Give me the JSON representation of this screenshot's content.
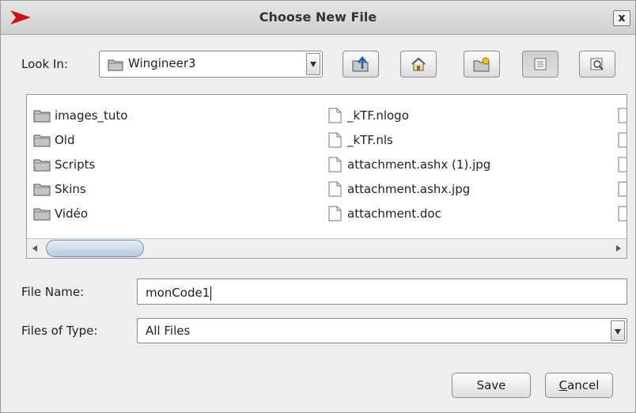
{
  "dialog": {
    "title": "Choose New File",
    "close_label": "x"
  },
  "look_in": {
    "label": "Look In:",
    "value": "Wingineer3"
  },
  "toolbar": [
    "up-one-level",
    "home",
    "new-folder",
    "list-view",
    "details-view"
  ],
  "folders": [
    {
      "name": "images_tuto"
    },
    {
      "name": "Old"
    },
    {
      "name": "Scripts"
    },
    {
      "name": "Skins"
    },
    {
      "name": "Vidéo"
    }
  ],
  "files": [
    {
      "name": "_kTF.nlogo"
    },
    {
      "name": "_kTF.nls"
    },
    {
      "name": "attachment.ashx (1).jpg"
    },
    {
      "name": "attachment.ashx.jpg"
    },
    {
      "name": "attachment.doc"
    }
  ],
  "file_name": {
    "label": "File Name:",
    "value": "monCode1"
  },
  "files_of_type": {
    "label": "Files of Type:",
    "value": "All Files"
  },
  "buttons": {
    "save": "Save",
    "cancel_prefix": "C",
    "cancel_rest": "ancel"
  },
  "colors": {
    "folder": "#b8b8b8",
    "selection": "#7c8ca8",
    "accent_red": "#cc1111"
  }
}
